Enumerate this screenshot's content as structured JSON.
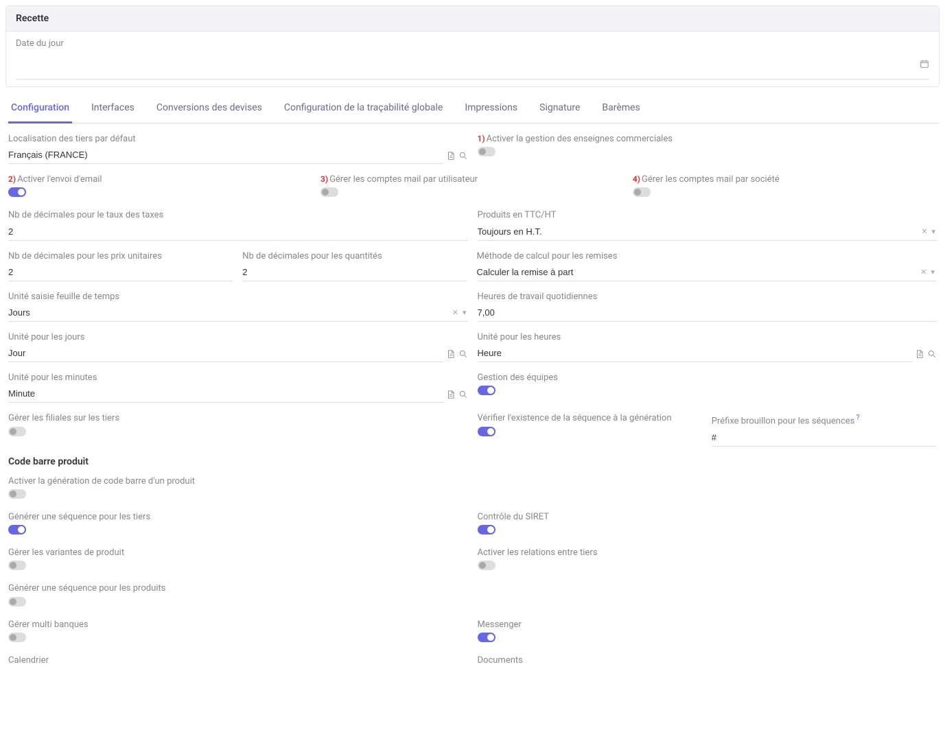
{
  "card": {
    "title": "Recette",
    "date_label": "Date du jour"
  },
  "tabs": [
    {
      "label": "Configuration",
      "active": true
    },
    {
      "label": "Interfaces"
    },
    {
      "label": "Conversions des devises"
    },
    {
      "label": "Configuration de la traçabilité globale"
    },
    {
      "label": "Impressions"
    },
    {
      "label": "Signature"
    },
    {
      "label": "Barèmes"
    }
  ],
  "markers": {
    "m1": "1)",
    "m2": "2)",
    "m3": "3)",
    "m4": "4)"
  },
  "fields": {
    "localisation": {
      "label": "Localisation des tiers par défaut",
      "value": "Français (FRANCE)"
    },
    "enseignes": {
      "label": "Activer la gestion des enseignes commerciales",
      "on": false
    },
    "email": {
      "label": "Activer l'envoi d'email",
      "on": true
    },
    "mail_user": {
      "label": "Gérer les comptes mail par utilisateur",
      "on": false
    },
    "mail_company": {
      "label": "Gérer les comptes mail par société",
      "on": false
    },
    "tax_dec": {
      "label": "Nb de décimales pour le taux des taxes",
      "value": "2"
    },
    "ttc": {
      "label": "Produits en TTC/HT",
      "value": "Toujours en H.T."
    },
    "unit_dec": {
      "label": "Nb de décimales pour les prix unitaires",
      "value": "2"
    },
    "qty_dec": {
      "label": "Nb de décimales pour les quantités",
      "value": "2"
    },
    "discount": {
      "label": "Méthode de calcul pour les remises",
      "value": "Calculer la remise à part"
    },
    "timesheet_unit": {
      "label": "Unité saisie feuille de temps",
      "value": "Jours"
    },
    "daily_hours": {
      "label": "Heures de travail quotidiennes",
      "value": "7,00"
    },
    "day_unit": {
      "label": "Unité pour les jours",
      "value": "Jour"
    },
    "hour_unit": {
      "label": "Unité pour les heures",
      "value": "Heure"
    },
    "minute_unit": {
      "label": "Unité pour les minutes",
      "value": "Minute"
    },
    "teams": {
      "label": "Gestion des équipes",
      "on": true
    },
    "subsidiaries": {
      "label": "Gérer les filiales sur les tiers",
      "on": false
    },
    "seq_check": {
      "label": "Vérifier l'existence de la séquence à la génération",
      "on": true
    },
    "draft_prefix": {
      "label": "Préfixe brouillon pour les séquences",
      "value": "#",
      "help": "?"
    },
    "barcode_section": "Code barre produit",
    "barcode_gen": {
      "label": "Activer la génération de code barre d'un produit",
      "on": false
    },
    "seq_partner": {
      "label": "Générer une séquence pour les tiers",
      "on": true
    },
    "siret": {
      "label": "Contrôle du SIRET",
      "on": true
    },
    "variants": {
      "label": "Gérer les variantes de produit",
      "on": false
    },
    "relations": {
      "label": "Activer les relations entre tiers",
      "on": false
    },
    "seq_product": {
      "label": "Générer une séquence pour les produits",
      "on": false
    },
    "multibank": {
      "label": "Gérer multi banques",
      "on": false
    },
    "messenger": {
      "label": "Messenger",
      "on": true
    },
    "calendar": {
      "label": "Calendrier"
    },
    "documents": {
      "label": "Documents"
    }
  }
}
